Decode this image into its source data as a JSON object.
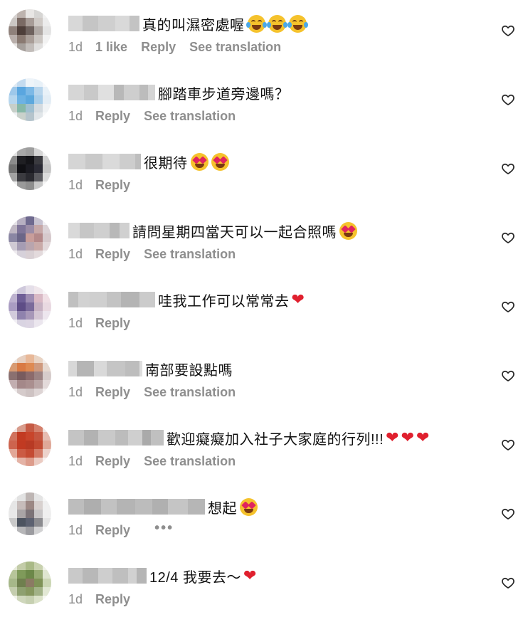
{
  "ui_colors": {
    "meta_text": "#8e8e8e",
    "body_text": "#111111",
    "heart_red": "#e0202e",
    "background": "#ffffff"
  },
  "comments": [
    {
      "text": "真的叫濕密處喔",
      "emoji": [
        "joy",
        "joy",
        "joy"
      ],
      "time": "1d",
      "likes": "1 like",
      "reply": "Reply",
      "translate": "See translation",
      "more": ""
    },
    {
      "text": "腳踏車步道旁邊嗎？",
      "emoji": [],
      "time": "1d",
      "likes": "",
      "reply": "Reply",
      "translate": "See translation",
      "more": ""
    },
    {
      "text": "很期待",
      "emoji": [
        "heart-eyes",
        "heart-eyes"
      ],
      "time": "1d",
      "likes": "",
      "reply": "Reply",
      "translate": "",
      "more": ""
    },
    {
      "text": "請問星期四當天可以一起合照嗎",
      "emoji": [
        "heart-eyes"
      ],
      "time": "1d",
      "likes": "",
      "reply": "Reply",
      "translate": "See translation",
      "more": ""
    },
    {
      "text": "哇我工作可以常常去",
      "emoji": [
        "red-heart"
      ],
      "time": "1d",
      "likes": "",
      "reply": "Reply",
      "translate": "",
      "more": ""
    },
    {
      "text": "南部要設點嗎",
      "emoji": [],
      "time": "1d",
      "likes": "",
      "reply": "Reply",
      "translate": "See translation",
      "more": ""
    },
    {
      "text": "歡迎癡癡加入社子大家庭的行列!!!",
      "emoji": [
        "red-heart",
        "red-heart",
        "red-heart"
      ],
      "time": "1d",
      "likes": "",
      "reply": "Reply",
      "translate": "See translation",
      "more": ""
    },
    {
      "text": "想起",
      "emoji": [
        "heart-eyes"
      ],
      "time": "1d",
      "likes": "",
      "reply": "Reply",
      "translate": "",
      "more": "•••"
    },
    {
      "text": "12/4 我要去～",
      "emoji": [
        "red-heart"
      ],
      "time": "1d",
      "likes": "",
      "reply": "Reply",
      "translate": "",
      "more": ""
    }
  ]
}
